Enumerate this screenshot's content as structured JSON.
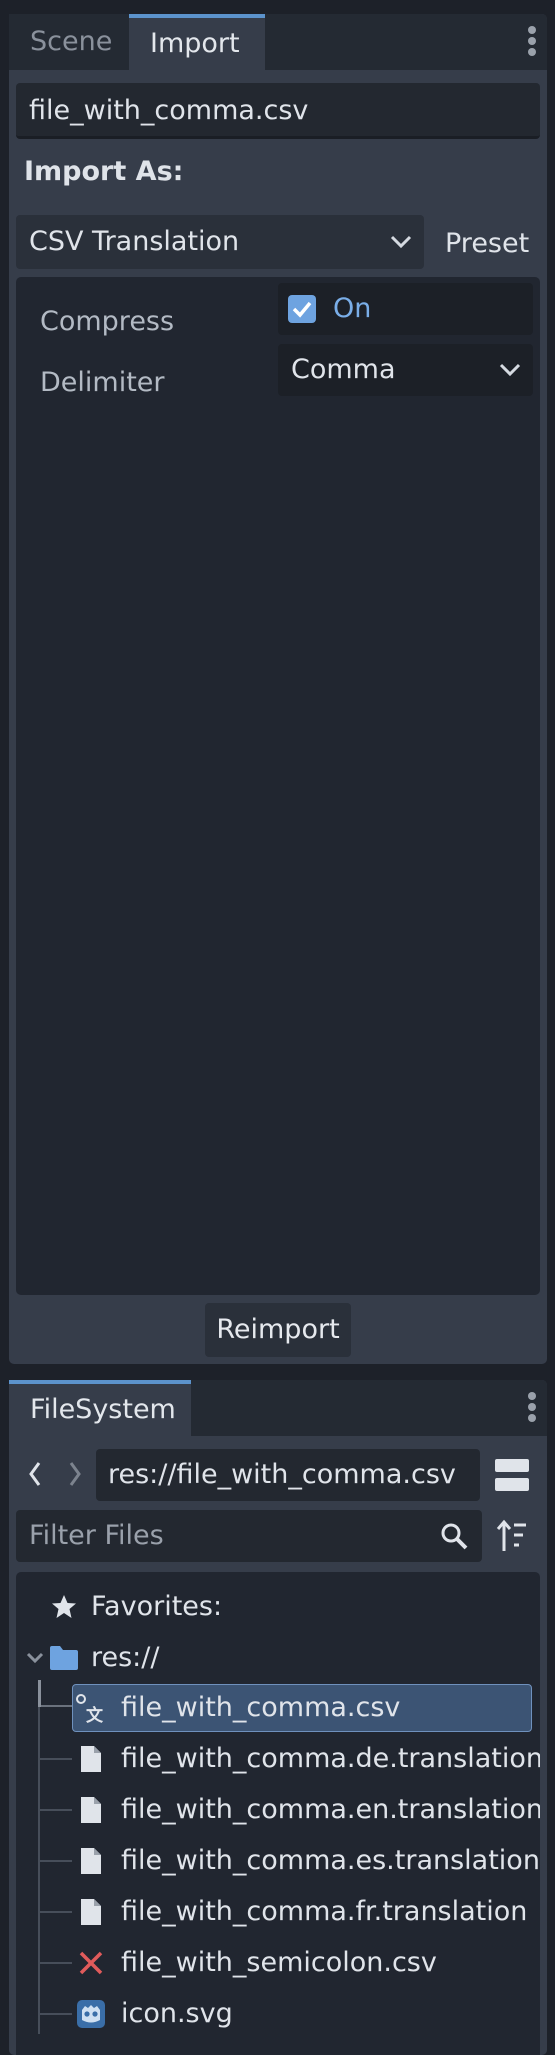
{
  "import_dock": {
    "tabs": [
      {
        "label": "Scene",
        "active": false
      },
      {
        "label": "Import",
        "active": true
      }
    ],
    "file_name": "file_with_comma.csv",
    "import_as_label": "Import As:",
    "importer_selected": "CSV Translation",
    "preset_label": "Preset",
    "options": {
      "compress": {
        "label": "Compress",
        "checked": true,
        "value_text": "On"
      },
      "delimiter": {
        "label": "Delimiter",
        "value": "Comma"
      }
    },
    "reimport_label": "Reimport"
  },
  "filesystem_dock": {
    "tab_label": "FileSystem",
    "path": "res://file_with_comma.csv",
    "filter_placeholder": "Filter Files",
    "favorites_label": "Favorites:",
    "root_label": "res://",
    "files": [
      {
        "name": "file_with_comma.csv",
        "icon": "translation-import-icon",
        "selected": true
      },
      {
        "name": "file_with_comma.de.translation",
        "icon": "file-icon",
        "selected": false
      },
      {
        "name": "file_with_comma.en.translation",
        "icon": "file-icon",
        "selected": false
      },
      {
        "name": "file_with_comma.es.translation",
        "icon": "file-icon",
        "selected": false
      },
      {
        "name": "file_with_comma.fr.translation",
        "icon": "file-icon",
        "selected": false
      },
      {
        "name": "file_with_semicolon.csv",
        "icon": "error-x-icon",
        "selected": false
      },
      {
        "name": "icon.svg",
        "icon": "godot-icon",
        "selected": false
      }
    ]
  },
  "colors": {
    "accent": "#5c93cc",
    "checkbox": "#6ea3e0",
    "error": "#e05b5b",
    "folder": "#6ea3e0"
  }
}
